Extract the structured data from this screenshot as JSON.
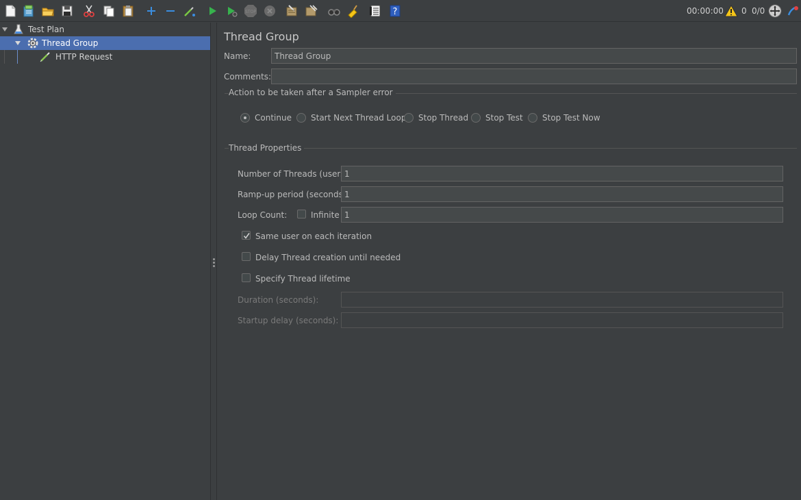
{
  "toolbar": {
    "icons": [
      "new-icon",
      "templates-icon",
      "open-icon",
      "save-icon",
      "cut-icon",
      "copy-icon",
      "paste-icon",
      "expand-icon",
      "collapse-icon",
      "toggle-icon",
      "start-icon",
      "start-no-pause-icon",
      "stop-icon",
      "shutdown-icon",
      "clear-icon",
      "clear-all-icon",
      "search-icon",
      "reset-search-icon",
      "function-helper-icon",
      "help-icon"
    ],
    "timer": "00:00:00",
    "warning_count": "0",
    "threads": "0/0"
  },
  "tree": {
    "items": [
      {
        "label": "Test Plan",
        "icon": "flask-icon"
      },
      {
        "label": "Thread Group",
        "icon": "gear-icon"
      },
      {
        "label": "HTTP Request",
        "icon": "pipette-icon"
      }
    ]
  },
  "panel": {
    "title": "Thread Group",
    "name_label": "Name:",
    "name_value": "Thread Group",
    "comments_label": "Comments:",
    "comments_value": "",
    "sampler_error": {
      "title": "Action to be taken after a Sampler error",
      "options": [
        "Continue",
        "Start Next Thread Loop",
        "Stop Thread",
        "Stop Test",
        "Stop Test Now"
      ],
      "selected": "Continue"
    },
    "thread_props": {
      "title": "Thread Properties",
      "threads_label": "Number of Threads (users):",
      "threads_value": "1",
      "rampup_label": "Ramp-up period (seconds):",
      "rampup_value": "1",
      "loop_label": "Loop Count:",
      "infinite_label": "Infinite",
      "loop_value": "1",
      "same_user_label": "Same user on each iteration",
      "delay_label": "Delay Thread creation until needed",
      "lifetime_label": "Specify Thread lifetime",
      "duration_label": "Duration (seconds):",
      "duration_value": "",
      "startup_label": "Startup delay (seconds):",
      "startup_value": ""
    }
  },
  "colors": {
    "background": "#3c3f41",
    "selection": "#4b6eaf",
    "field": "#45494a"
  }
}
